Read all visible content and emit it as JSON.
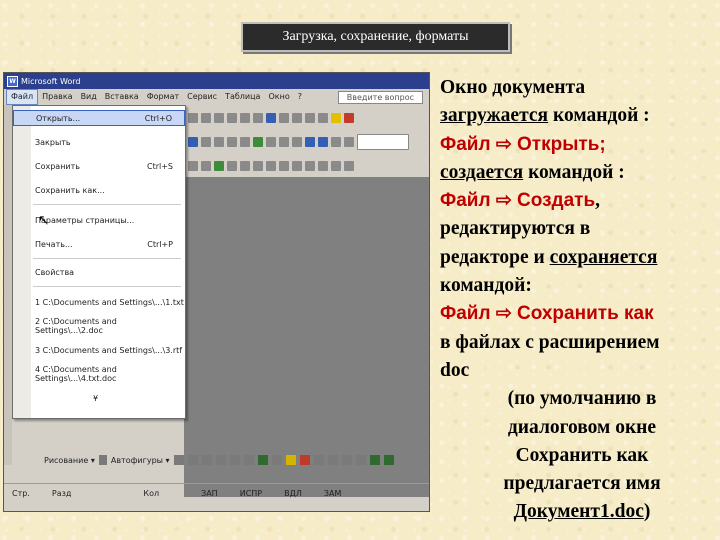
{
  "slide_title": "Загрузка, сохранение, форматы",
  "app": {
    "window_title": "Microsoft Word",
    "menu": [
      "Файл",
      "Правка",
      "Вид",
      "Вставка",
      "Формат",
      "Сервис",
      "Таблица",
      "Окно",
      "?"
    ],
    "help_box": "Введите вопрос",
    "file_menu": [
      {
        "label": "Открыть...",
        "shortcut": "Ctrl+O"
      },
      {
        "label": "Закрыть",
        "shortcut": ""
      },
      {
        "label": "Сохранить",
        "shortcut": "Ctrl+S"
      },
      {
        "label": "Сохранить как...",
        "shortcut": ""
      },
      {
        "label": "Параметры страницы...",
        "shortcut": ""
      },
      {
        "label": "Печать...",
        "shortcut": "Ctrl+P"
      },
      {
        "label": "Свойства",
        "shortcut": ""
      },
      {
        "label": "1 C:\\Documents and Settings\\...\\1.txt",
        "shortcut": ""
      },
      {
        "label": "2 C:\\Documents and Settings\\...\\2.doc",
        "shortcut": ""
      },
      {
        "label": "3 C:\\Documents and Settings\\...\\3.rtf",
        "shortcut": ""
      },
      {
        "label": "4 C:\\Documents and Settings\\...\\4.txt.doc",
        "shortcut": ""
      }
    ],
    "more_arrow": "¥",
    "draw_label": "Рисование ▾",
    "autoshapes_label": "Автофигуры ▾",
    "status": [
      "Стр.",
      "Разд",
      "Кол",
      "ЗАП",
      "ИСПР",
      "ВДЛ",
      "ЗАМ"
    ]
  },
  "text": {
    "l1": "Окно документа",
    "l2a": "загружается",
    "l2b": " командой :",
    "l3": "Файл ⇨ Открыть;",
    "l4a": "создается",
    "l4b": " командой :",
    "l5": "Файл ⇨ Создать",
    "l5b": ",",
    "l6": "редактируются в",
    "l7a": "редакторе и ",
    "l7b": "сохраняется",
    "l8": "командой:",
    "l9": "Файл ⇨ Сохранить как",
    "l10": "в файлах с расширением",
    "l11": "doc",
    "l12": "(по умолчанию в",
    "l13": "диалоговом окне",
    "l14": "Сохранить как",
    "l15": "предлагается имя",
    "l16a": "Документ1.doc",
    "l16b": ")"
  }
}
